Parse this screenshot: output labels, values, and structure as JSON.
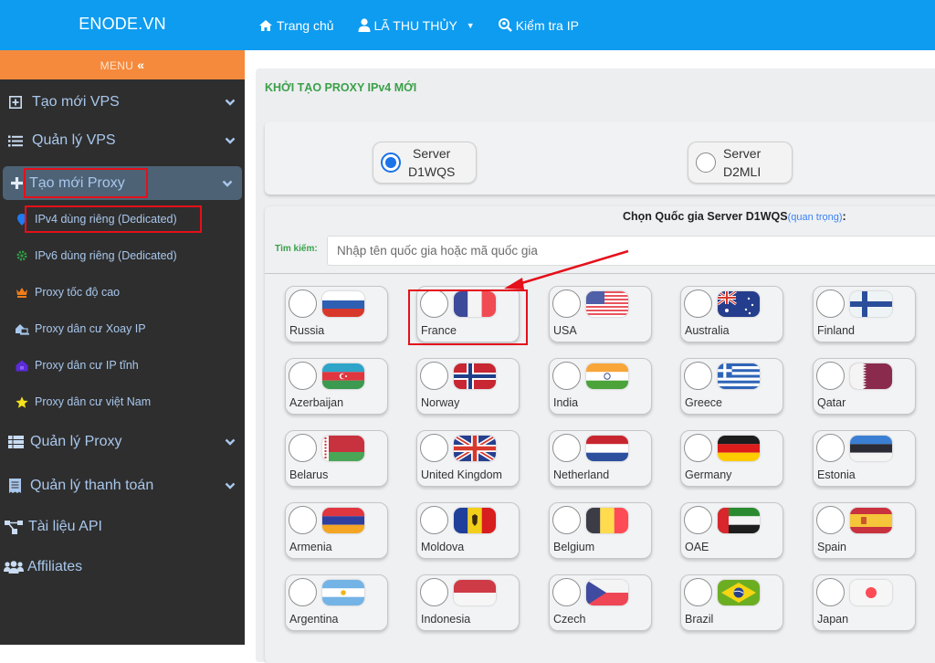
{
  "topbar": {
    "brand": "ENODE.VN",
    "nav": [
      {
        "label": "Trang chủ",
        "icon": "home-icon"
      },
      {
        "label": "LÃ THU THỦY",
        "icon": "user-icon",
        "has_dropdown": true
      },
      {
        "label": "Kiểm tra IP",
        "icon": "search-location-icon"
      }
    ]
  },
  "sidebar": {
    "menu_label": "MENU",
    "menu_toggle_glyph": "«",
    "items": [
      {
        "label": "Tạo mới VPS",
        "icon": "plus-square-icon",
        "has_chevron": true
      },
      {
        "label": "Quản lý VPS",
        "icon": "list-icon",
        "has_chevron": true
      },
      {
        "label": "Tạo mới Proxy",
        "icon": "plus-icon",
        "has_chevron": true,
        "active": true
      },
      {
        "label": "Quản lý Proxy",
        "icon": "table-icon",
        "has_chevron": true
      },
      {
        "label": "Quản lý thanh toán",
        "icon": "receipt-icon",
        "has_chevron": true
      },
      {
        "label": "Tài liệu API",
        "icon": "sitemap-icon",
        "has_chevron": false
      },
      {
        "label": "Affiliates",
        "icon": "users-icon",
        "has_chevron": false
      }
    ],
    "subitems": [
      {
        "label": "IPv4 dùng riêng (Dedicated)",
        "icon": "map-marker-icon",
        "color": "#1e7bf2",
        "highlighted": true
      },
      {
        "label": "IPv6 dùng riêng (Dedicated)",
        "icon": "gear-icon",
        "color": "#2ea043"
      },
      {
        "label": "Proxy tốc độ cao",
        "icon": "crown-icon",
        "color": "#f07c18"
      },
      {
        "label": "Proxy dân cư Xoay IP",
        "icon": "house-laptop-icon",
        "color": "#a9c7ec"
      },
      {
        "label": "Proxy dân cư IP tĩnh",
        "icon": "house-lock-icon",
        "color": "#5b2bd8"
      },
      {
        "label": "Proxy dân cư việt Nam",
        "icon": "star-icon",
        "color": "#f7e21b"
      }
    ]
  },
  "main": {
    "title": "KHỞI TẠO PROXY IPv4 MỚI",
    "servers": [
      {
        "line1": "Server",
        "line2": "D1WQS",
        "selected": true
      },
      {
        "line1": "Server",
        "line2": "D2MLI",
        "selected": false
      }
    ],
    "country_section": {
      "title": "Chọn Quốc gia Server D1WQS",
      "hint": "(quan trọng)",
      "suffix": ":",
      "search_label": "Tìm kiếm:",
      "search_placeholder": "Nhập tên quốc gia hoặc mã quốc gia",
      "search_value": ""
    },
    "countries": [
      {
        "name": "Russia",
        "flag": "ru"
      },
      {
        "name": "France",
        "flag": "fr",
        "highlighted": true
      },
      {
        "name": "USA",
        "flag": "us"
      },
      {
        "name": "Australia",
        "flag": "au"
      },
      {
        "name": "Finland",
        "flag": "fi"
      },
      {
        "name": "Azerbaijan",
        "flag": "az"
      },
      {
        "name": "Norway",
        "flag": "no"
      },
      {
        "name": "India",
        "flag": "in"
      },
      {
        "name": "Greece",
        "flag": "gr"
      },
      {
        "name": "Qatar",
        "flag": "qa"
      },
      {
        "name": "Belarus",
        "flag": "by"
      },
      {
        "name": "United Kingdom",
        "flag": "gb"
      },
      {
        "name": "Netherland",
        "flag": "nl"
      },
      {
        "name": "Germany",
        "flag": "de"
      },
      {
        "name": "Estonia",
        "flag": "ee"
      },
      {
        "name": "Armenia",
        "flag": "am"
      },
      {
        "name": "Moldova",
        "flag": "md"
      },
      {
        "name": "Belgium",
        "flag": "be"
      },
      {
        "name": "OAE",
        "flag": "ae"
      },
      {
        "name": "Spain",
        "flag": "es"
      },
      {
        "name": "Argentina",
        "flag": "ar"
      },
      {
        "name": "Indonesia",
        "flag": "id"
      },
      {
        "name": "Czech",
        "flag": "cz"
      },
      {
        "name": "Brazil",
        "flag": "br"
      },
      {
        "name": "Japan",
        "flag": "jp"
      }
    ]
  },
  "colors": {
    "topbar": "#0d9cf0",
    "menu_bar": "#f58a3c",
    "sidebar_bg": "#2e2e2e",
    "sidebar_active": "#4d6275",
    "sidebar_text": "#a9c7ec",
    "title_green": "#3aa04a",
    "annotation_red": "#e5101a",
    "radio_blue": "#1a73e8"
  }
}
